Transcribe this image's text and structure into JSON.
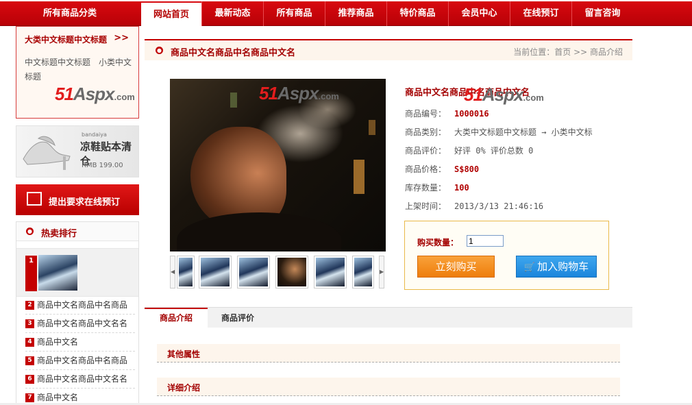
{
  "nav": {
    "all_categories": "所有商品分类",
    "items": [
      "网站首页",
      "最新动态",
      "所有商品",
      "推荐商品",
      "特价商品",
      "会员中心",
      "在线预订",
      "留言咨询"
    ]
  },
  "category": {
    "title": "大类中文标题中文标题",
    "arrows": ">>",
    "sub": "中文标题中文标题　小类中文标题"
  },
  "watermark": {
    "n": "51",
    "t": "Aspx",
    "c": ".com"
  },
  "banner": {
    "brand": "bandaiya",
    "headline": "凉鞋贴本清仓",
    "price": "RMB 199.00"
  },
  "order_button": {
    "label": "提出要求在线预订"
  },
  "hot": {
    "title": "热卖排行",
    "first_num": "1",
    "items": [
      {
        "num": "2",
        "text": "商品中文名商品中名商品"
      },
      {
        "num": "3",
        "text": "商品中文名商品中文名名"
      },
      {
        "num": "4",
        "text": "商品中文名"
      },
      {
        "num": "5",
        "text": "商品中文名商品中名商品"
      },
      {
        "num": "6",
        "text": "商品中文名商品中文名名"
      },
      {
        "num": "7",
        "text": "商品中文名"
      }
    ]
  },
  "crumbbar": {
    "title": "商品中文名商品中名商品中文名",
    "crumb": "当前位置：首页 >> 商品介绍"
  },
  "product": {
    "name": "商品中文名商品中名商品中文名",
    "fields": [
      {
        "label": "商品编号：",
        "value": "1000016",
        "highlight": true
      },
      {
        "label": "商品类别：",
        "value": "大类中文标题中文标题 → 小类中文标",
        "highlight": false
      },
      {
        "label": "商品评价：",
        "value": "好评 0%  评价总数 0",
        "highlight": false
      },
      {
        "label": "商品价格：",
        "value": "S$800",
        "highlight": true
      },
      {
        "label": "库存数量：",
        "value": "100",
        "highlight": true
      },
      {
        "label": "上架时间：",
        "value": "2013/3/13 21:46:16",
        "highlight": false
      }
    ]
  },
  "buy": {
    "qty_label": "购买数量：",
    "qty_value": "1",
    "buy_now": "立刻购买",
    "add_cart": "加入购物车"
  },
  "tabs": [
    "商品介绍",
    "商品评价"
  ],
  "sections": [
    "其他属性",
    "详细介绍"
  ],
  "colors": {
    "brand_red": "#c40000",
    "dark_red": "#a30000",
    "orange": "#ee7d0c",
    "blue": "#1a85dc"
  }
}
